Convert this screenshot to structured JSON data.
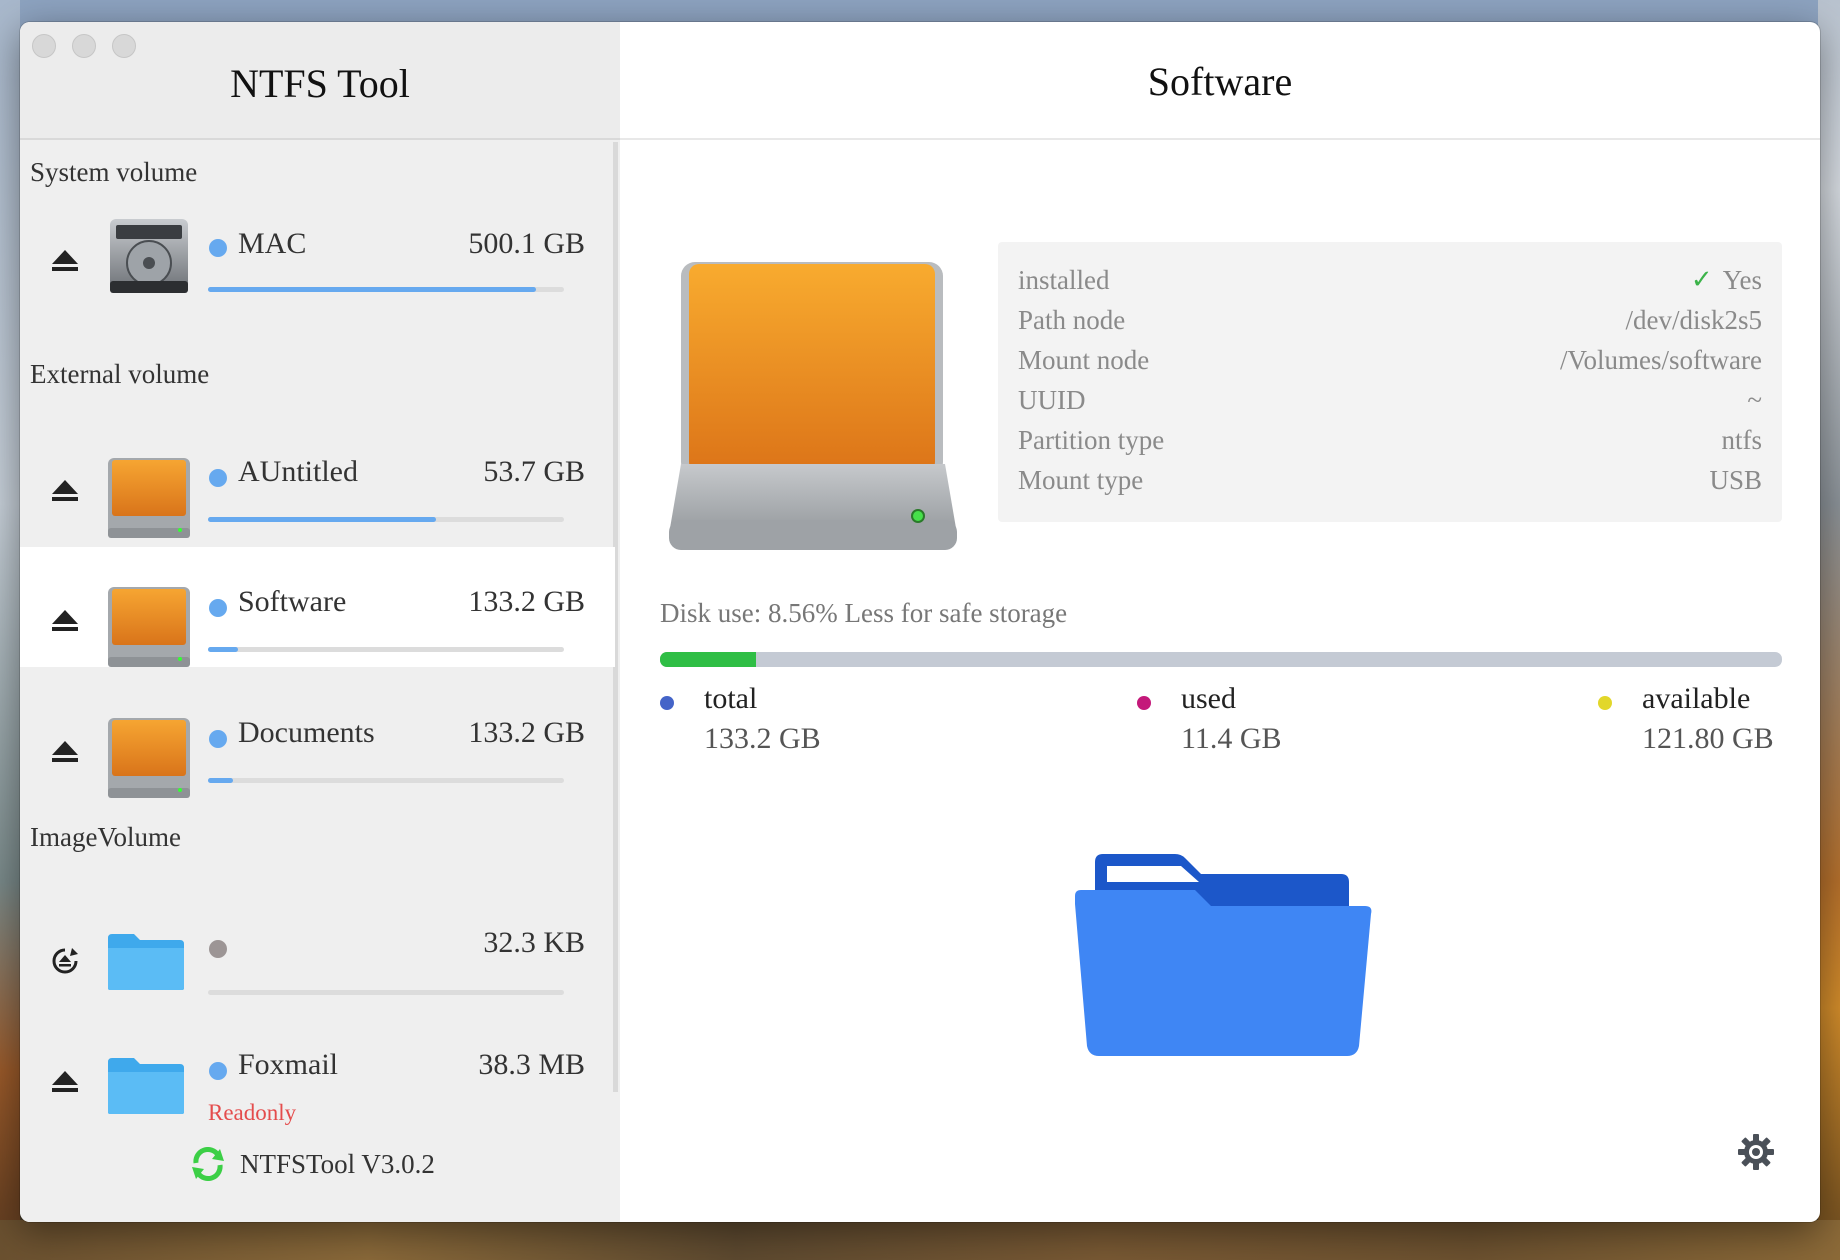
{
  "app": {
    "title": "NTFS Tool",
    "version": "NTFSTool V3.0.2"
  },
  "sections": {
    "system": "System volume",
    "external": "External volume",
    "image": "ImageVolume"
  },
  "volumes": [
    {
      "name": "MAC",
      "size": "500.1 GB",
      "usage": 0.92,
      "dot_color": "#66a9ef",
      "icon": "hard-disk-icon",
      "action": "eject-icon"
    },
    {
      "name": "AUntitled",
      "size": "53.7 GB",
      "usage": 0.64,
      "dot_color": "#66a9ef",
      "icon": "external-drive-icon",
      "action": "eject-icon"
    },
    {
      "name": "Software",
      "size": "133.2 GB",
      "usage": 0.0856,
      "dot_color": "#66a9ef",
      "icon": "external-drive-icon",
      "action": "eject-icon",
      "selected": true
    },
    {
      "name": "Documents",
      "size": "133.2 GB",
      "usage": 0.07,
      "dot_color": "#66a9ef",
      "icon": "external-drive-icon",
      "action": "eject-icon"
    },
    {
      "name": "",
      "size": "32.3 KB",
      "usage": 0.0,
      "dot_color": "#9c9595",
      "icon": "folder-icon",
      "action": "remount-icon"
    },
    {
      "name": "Foxmail",
      "size": "38.3 MB",
      "dot_color": "#66a9ef",
      "icon": "folder-icon",
      "action": "eject-icon",
      "badge": "Readonly"
    }
  ],
  "detail": {
    "title": "Software",
    "info": [
      {
        "label": "installed",
        "value": "Yes"
      },
      {
        "label": "Path node",
        "value": "/dev/disk2s5"
      },
      {
        "label": "Mount node",
        "value": "/Volumes/software"
      },
      {
        "label": "UUID",
        "value": "~"
      },
      {
        "label": "Partition type",
        "value": "ntfs"
      },
      {
        "label": "Mount type",
        "value": "USB"
      }
    ],
    "disk_use_text": "Disk use: 8.56% Less for safe storage",
    "disk_use_fraction": 0.0856,
    "legend": [
      {
        "name": "total",
        "value": "133.2 GB",
        "color": "#4464c8"
      },
      {
        "name": "used",
        "value": "11.4 GB",
        "color": "#c4197a"
      },
      {
        "name": "available",
        "value": "121.80 GB",
        "color": "#e2d72a"
      }
    ]
  },
  "colors": {
    "accent": "#66a9ef",
    "readonly": "#e44c4c",
    "usage_fill": "#2fbe45"
  }
}
